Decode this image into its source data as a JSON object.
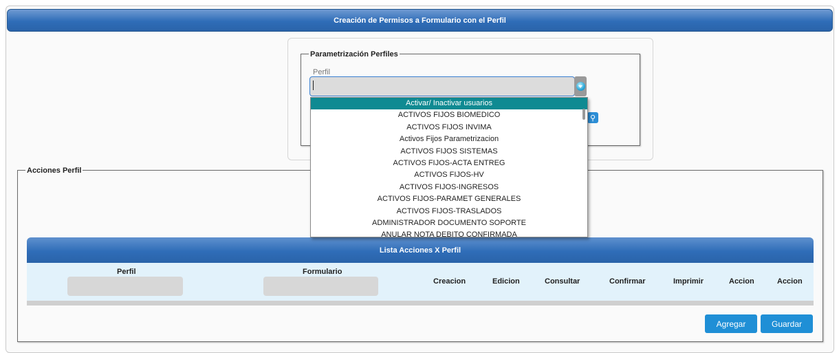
{
  "header": {
    "title": "Creación de Permisos a Formulario con el Perfil"
  },
  "param_section": {
    "legend": "Parametrización Perfiles",
    "perfil_label": "Perfil",
    "perfil_value": "",
    "dropdown_options": [
      "Activar/ Inactivar usuarios",
      "ACTIVOS FIJOS BIOMEDICO",
      "ACTIVOS FIJOS INVIMA",
      "Activos Fijos Parametrizacion",
      "ACTIVOS FIJOS SISTEMAS",
      "ACTIVOS FIJOS-ACTA ENTREG",
      "ACTIVOS FIJOS-HV",
      "ACTIVOS FIJOS-INGRESOS",
      "ACTIVOS FIJOS-PARAMET GENERALES",
      "ACTIVOS FIJOS-TRASLADOS",
      "ADMINISTRADOR DOCUMENTO SOPORTE",
      "ANULAR NOTA DEBITO CONFIRMADA"
    ],
    "selected_option": "Activar/ Inactivar usuarios"
  },
  "acciones_section": {
    "legend": "Acciones Perfil",
    "table_title": "Lista Acciones X Perfil",
    "columns": {
      "perfil": "Perfil",
      "formulario": "Formulario",
      "creacion": "Creacion",
      "edicion": "Edicion",
      "consultar": "Consultar",
      "confirmar": "Confirmar",
      "imprimir": "Imprimir",
      "accion1": "Accion",
      "accion2": "Accion"
    },
    "buttons": {
      "agregar": "Agregar",
      "guardar": "Guardar"
    }
  },
  "colors": {
    "header_blue": "#2f6db8",
    "selected_option": "#0f8a92",
    "table_body": "#e2f2fb",
    "button_blue": "#1f8fd6"
  }
}
